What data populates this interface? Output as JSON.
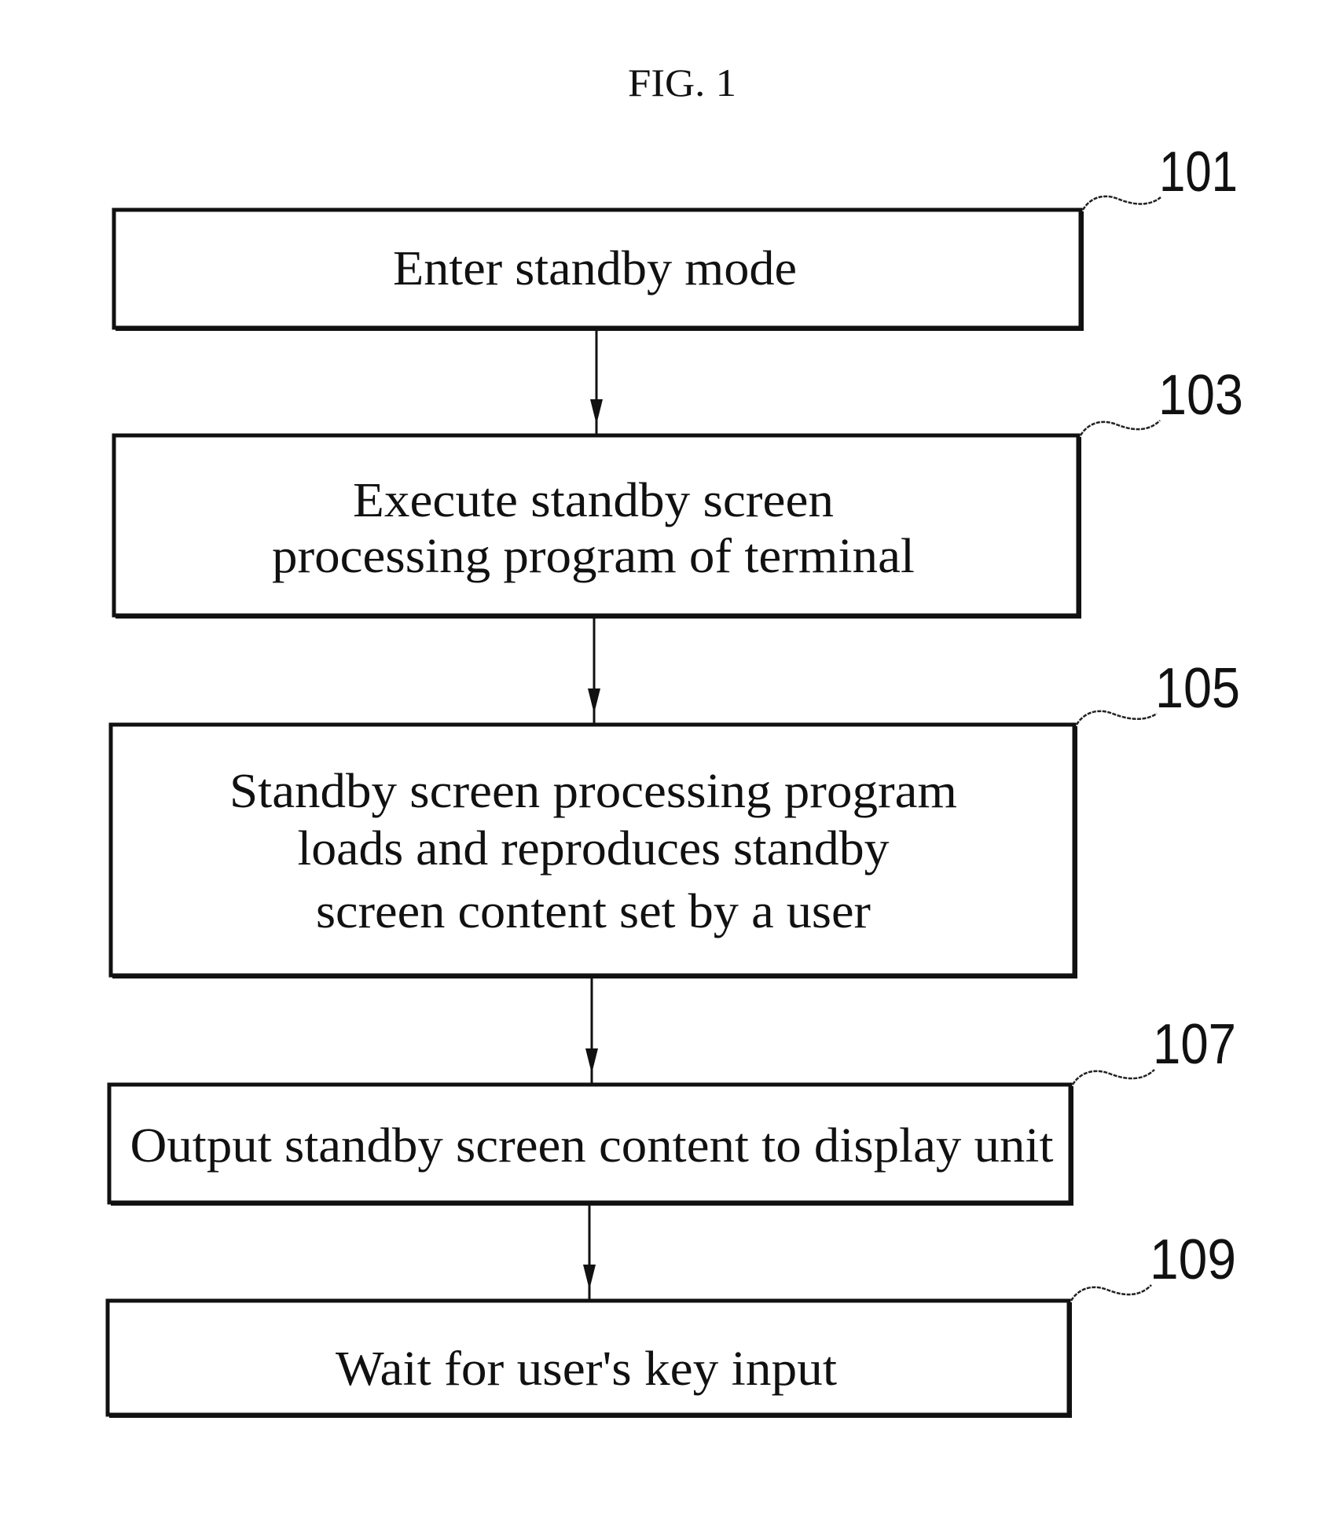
{
  "figure": {
    "title": "FIG. 1",
    "type": "flowchart",
    "steps": [
      {
        "ref": "101",
        "lines": [
          "Enter standby mode"
        ]
      },
      {
        "ref": "103",
        "lines": [
          "Execute standby screen",
          "processing program of terminal"
        ]
      },
      {
        "ref": "105",
        "lines": [
          "Standby screen processing program",
          "loads and reproduces standby",
          "screen content set by a user"
        ]
      },
      {
        "ref": "107",
        "lines": [
          "Output standby screen content to display unit"
        ]
      },
      {
        "ref": "109",
        "lines": [
          "Wait for user's key input"
        ]
      }
    ],
    "connections": [
      {
        "from": "101",
        "to": "103"
      },
      {
        "from": "103",
        "to": "105"
      },
      {
        "from": "105",
        "to": "107"
      },
      {
        "from": "107",
        "to": "109"
      }
    ]
  }
}
